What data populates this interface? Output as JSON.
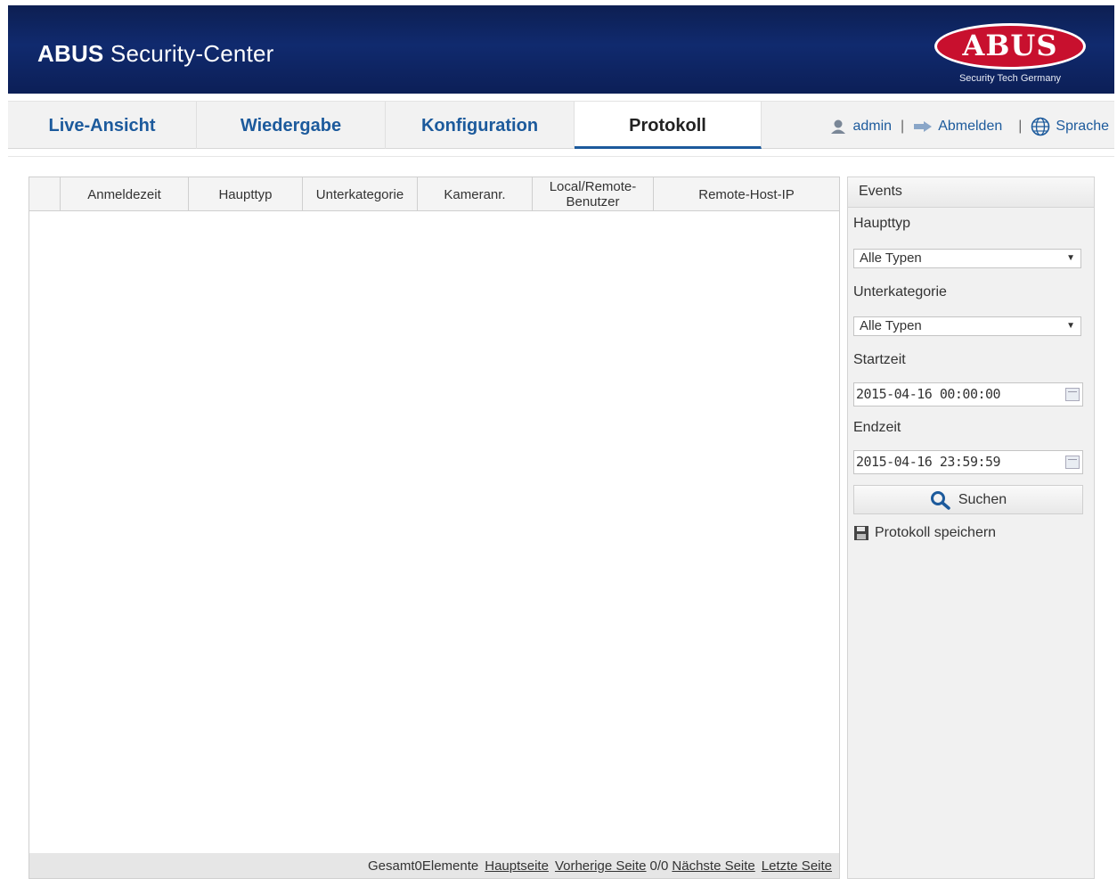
{
  "header": {
    "app_title_bold": "ABUS",
    "app_title_rest": " Security-Center",
    "logo_text": "ABUS",
    "logo_subtitle": "Security Tech Germany"
  },
  "tabs": [
    {
      "label": "Live-Ansicht",
      "active": false
    },
    {
      "label": "Wiedergabe",
      "active": false
    },
    {
      "label": "Konfiguration",
      "active": false
    },
    {
      "label": "Protokoll",
      "active": true
    }
  ],
  "user_area": {
    "user": "admin",
    "separator": "|",
    "logout": "Abmelden",
    "language": "Sprache"
  },
  "table": {
    "columns": [
      "",
      "Anmeldezeit",
      "Haupttyp",
      "Unterkategorie",
      "Kameranr.",
      "Local/Remote-Benutzer",
      "Remote-Host-IP"
    ],
    "rows": []
  },
  "pagination": {
    "total": "Gesamt0Elemente",
    "first": "Hauptseite",
    "prev": "Vorherige Seite",
    "page": "0/0",
    "next": "Nächste Seite",
    "last": "Letzte Seite"
  },
  "sidebar": {
    "title": "Events",
    "haupttyp_label": "Haupttyp",
    "haupttyp_value": "Alle Typen",
    "unterkategorie_label": "Unterkategorie",
    "unterkategorie_value": "Alle Typen",
    "startzeit_label": "Startzeit",
    "startzeit_value": "2015-04-16 00:00:00",
    "endzeit_label": "Endzeit",
    "endzeit_value": "2015-04-16 23:59:59",
    "search_label": "Suchen",
    "save_label": "Protokoll speichern"
  },
  "colors": {
    "banner": "#102a6e",
    "tab_text": "#1c5a9c",
    "logo_red": "#c8102e"
  }
}
